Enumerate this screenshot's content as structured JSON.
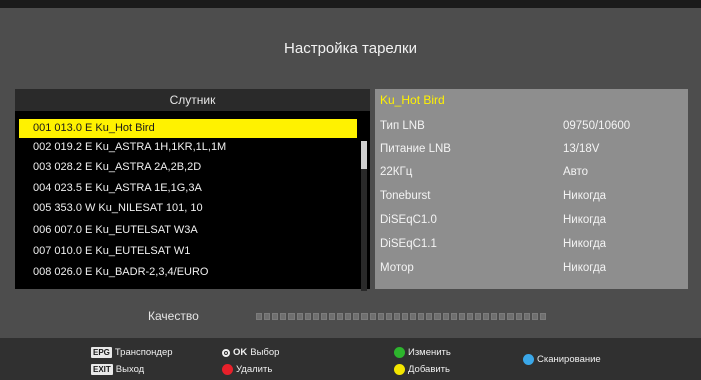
{
  "screen": {
    "title": "Настройка тарелки"
  },
  "satellite_list": {
    "header": "Слутник",
    "selected_index": 0,
    "rows": [
      "001 013.0 E  Ku_Hot Bird",
      "002 019.2 E  Ku_ASTRA 1H,1KR,1L,1M",
      "003 028.2 E  Ku_ASTRA 2A,2B,2D",
      "004 023.5 E  Ku_ASTRA 1E,1G,3A",
      "005 353.0 W  Ku_NILESAT 101, 10",
      "006 007.0 E  Ku_EUTELSAT W3A",
      "007 010.0 E  Ku_EUTELSAT W1",
      "008 026.0 E  Ku_BADR-2,3,4/EURO"
    ]
  },
  "details": {
    "title": "Ku_Hot Bird",
    "params": [
      {
        "label": "Тип LNB",
        "value": "09750/10600"
      },
      {
        "label": "Питание LNB",
        "value": "13/18V"
      },
      {
        "label": "22КГц",
        "value": "Авто"
      },
      {
        "label": "Toneburst",
        "value": "Никогда"
      },
      {
        "label": "DiSEqC1.0",
        "value": "Никогда"
      },
      {
        "label": "DiSEqC1.1",
        "value": "Никогда"
      },
      {
        "label": "Мотор",
        "value": "Никогда"
      }
    ]
  },
  "quality": {
    "label": "Качество",
    "level": 0,
    "segments": 36
  },
  "help": {
    "epg_key": "EPG",
    "epg_label": "Транспондер",
    "exit_key": "EXIT",
    "exit_label": "Выход",
    "ok_key": "OK",
    "ok_label": "Выбор",
    "red_label": "Удалить",
    "green_label": "Изменить",
    "yellow_label": "Добавить",
    "blue_label": "Сканирование"
  },
  "colors": {
    "highlight": "#fff200",
    "red": "#e8202a",
    "green": "#2db52d",
    "yellow": "#f4e600",
    "blue": "#3aa7e8"
  }
}
